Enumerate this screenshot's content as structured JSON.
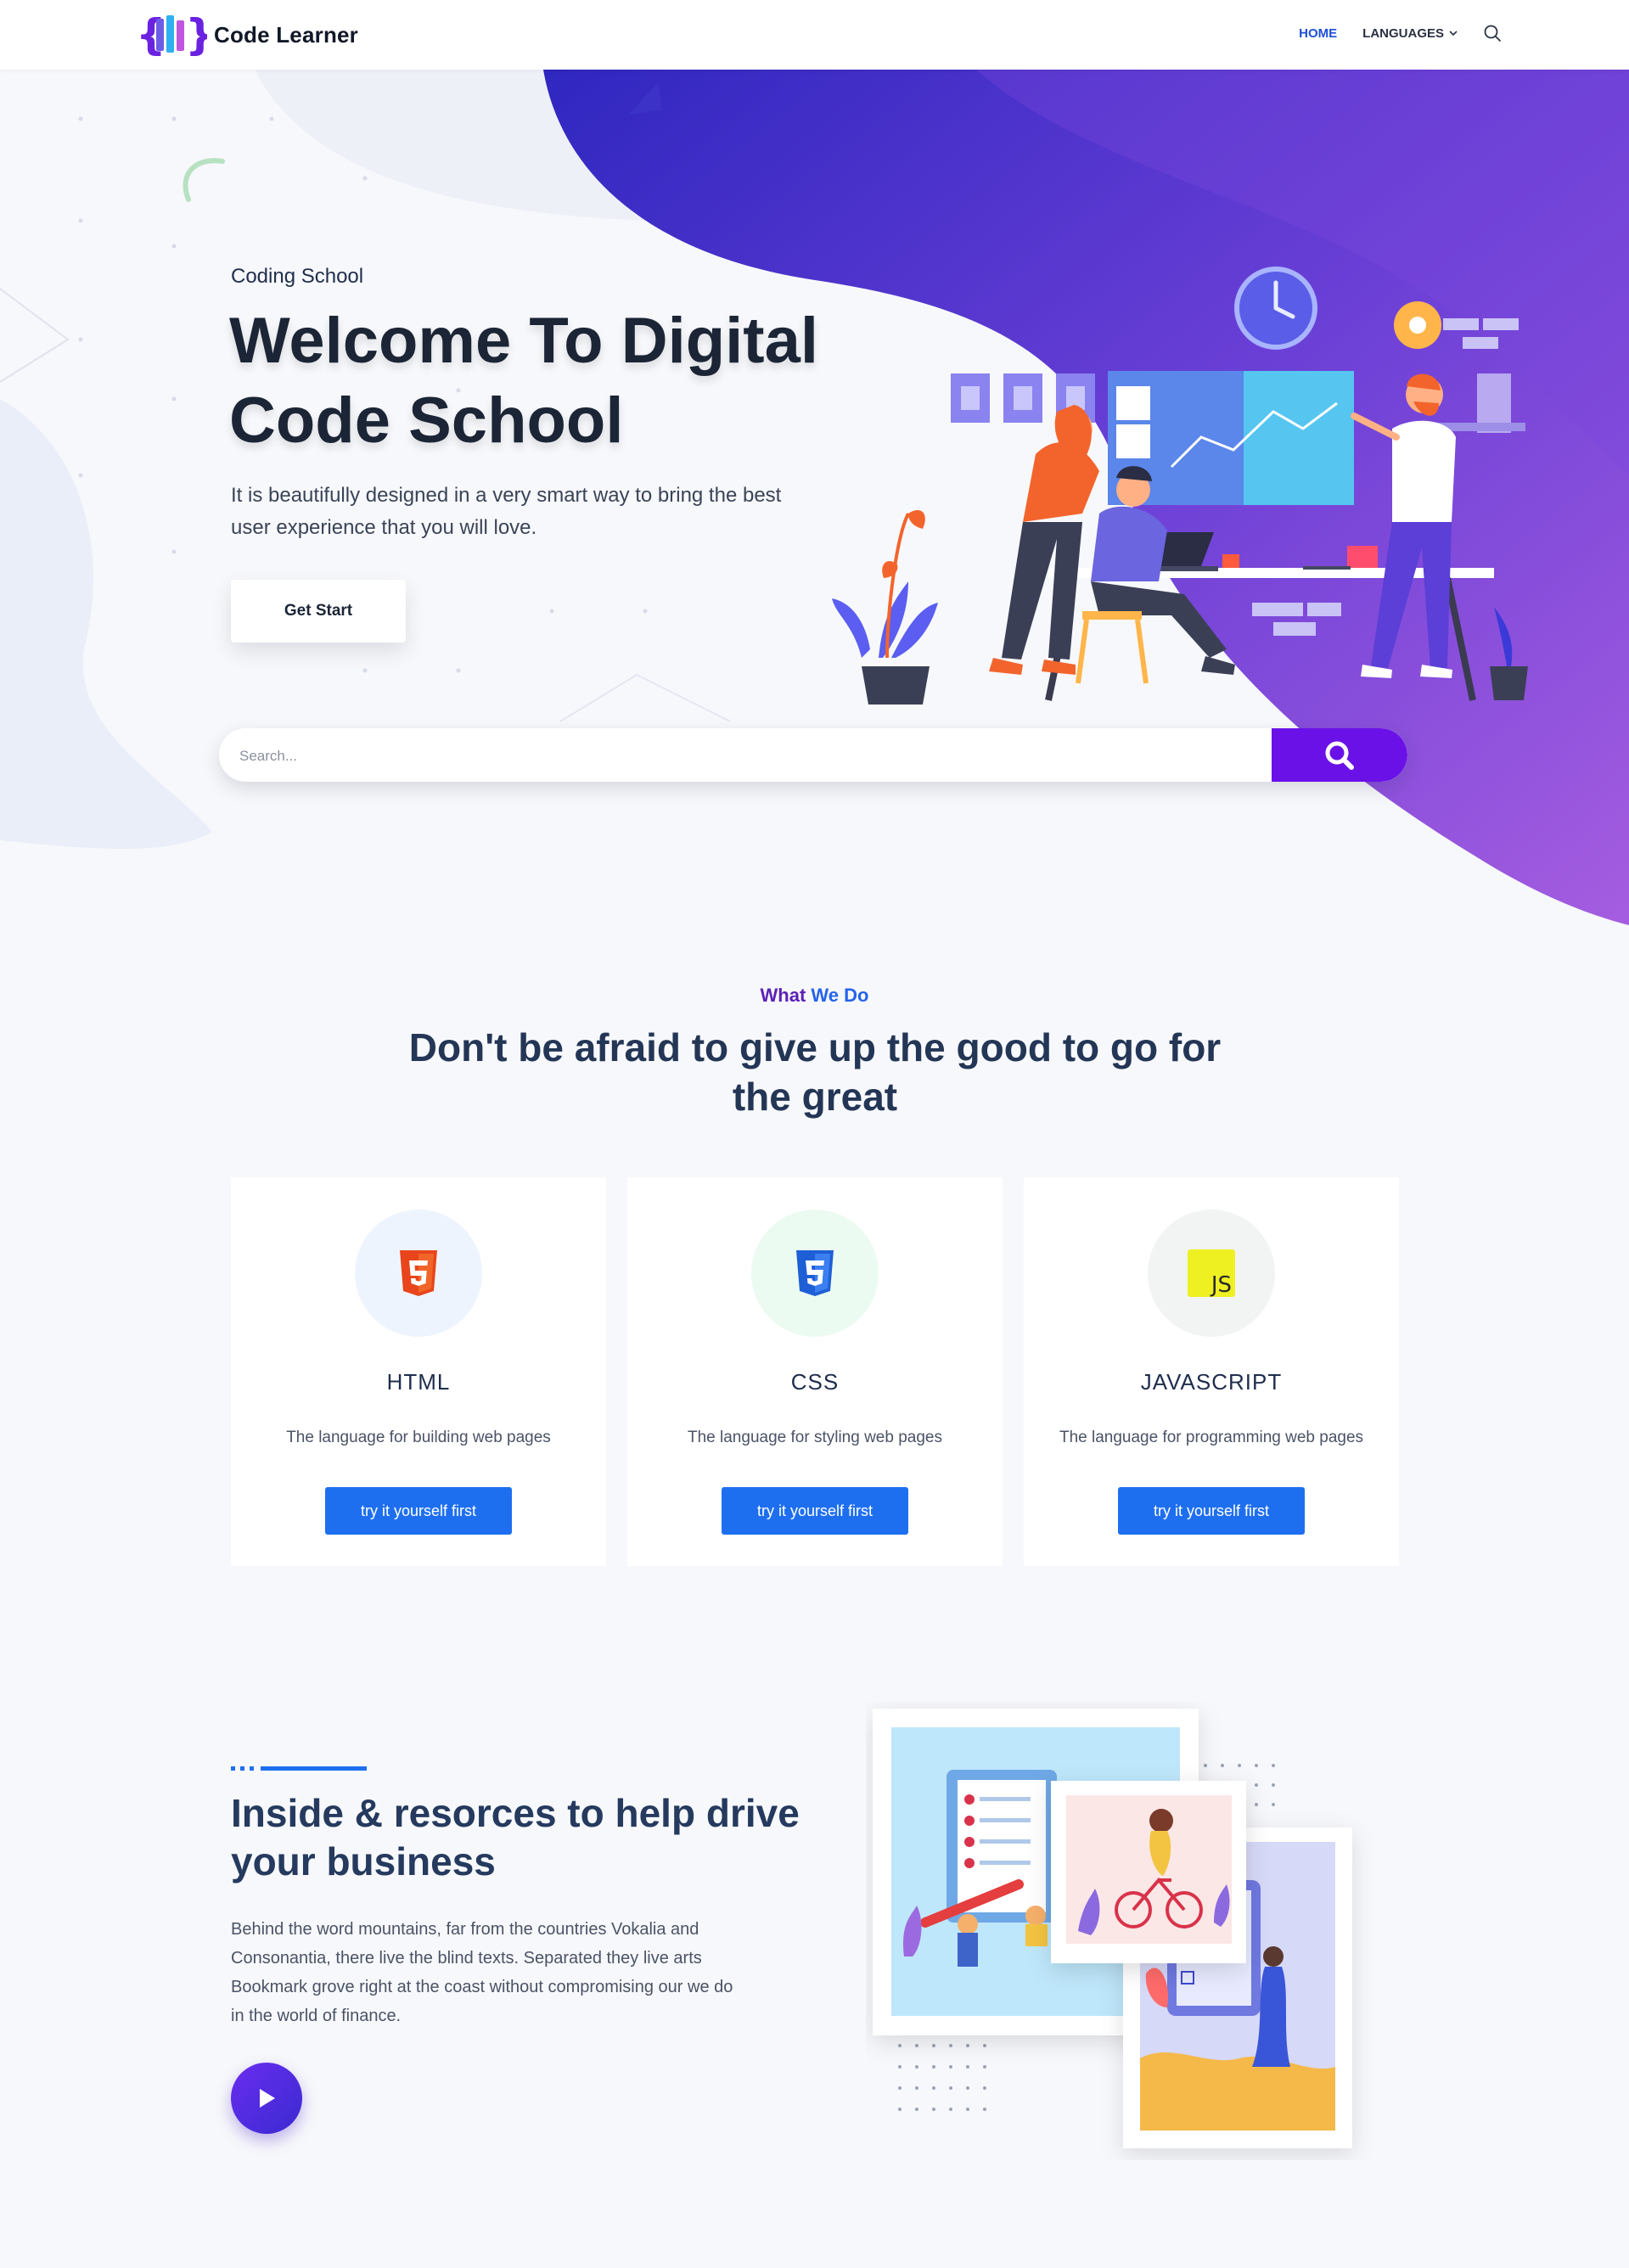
{
  "header": {
    "logo_text": "Code Learner",
    "nav": {
      "home": "HOME",
      "languages": "LANGUAGES"
    }
  },
  "hero": {
    "kicker": "Coding School",
    "title_line1": "Welcome To Digital",
    "title_line2": "Code School",
    "description": "It is beautifully designed in a very smart way to bring the best user experience that you will love.",
    "cta_label": "Get Start",
    "search_placeholder": "Search..."
  },
  "what_we_do": {
    "kicker_part1": "What",
    "kicker_part2": "We Do",
    "title": "Don't be afraid to give up the good to go for the great",
    "cards": [
      {
        "title": "HTML",
        "description": "The language for building web pages",
        "button": "try it yourself first",
        "icon": "html5-icon"
      },
      {
        "title": "CSS",
        "description": "The language for styling web pages",
        "button": "try it yourself first",
        "icon": "css3-icon"
      },
      {
        "title": "JAVASCRIPT",
        "description": "The language for programming web pages",
        "button": "try it yourself first",
        "icon": "javascript-icon"
      }
    ]
  },
  "inside": {
    "title": "Inside & resorces to help drive your business",
    "description": "Behind the word mountains, far from the countries Vokalia and Consonantia, there live the blind texts. Separated they live arts Bookmark grove right at the coast without compromising our we do in the world of finance."
  },
  "colors": {
    "accent_purple": "#6a11e8",
    "button_blue": "#1e6ff0",
    "nav_active": "#1e4fd8",
    "kicker_purple": "#5b21b6",
    "kicker_blue": "#2563eb"
  }
}
